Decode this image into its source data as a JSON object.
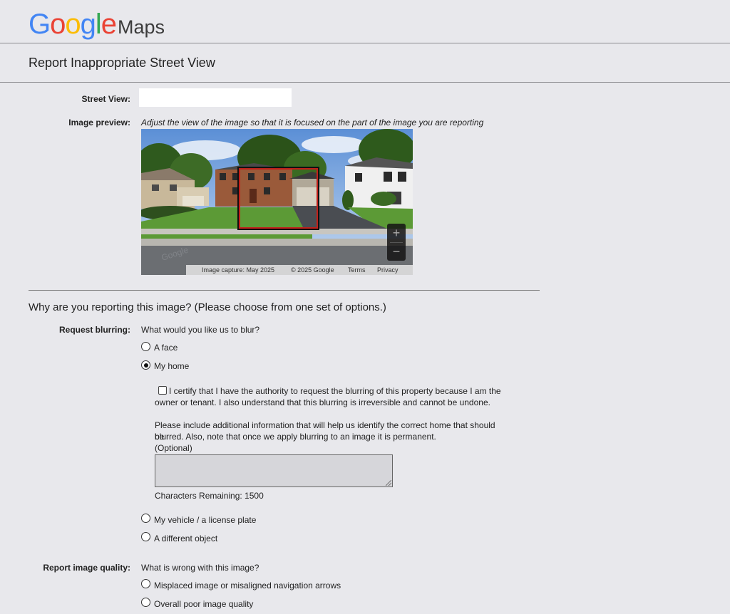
{
  "header": {
    "logo_letters": [
      {
        "ch": "G",
        "color": "#4285F4"
      },
      {
        "ch": "o",
        "color": "#EA4335"
      },
      {
        "ch": "o",
        "color": "#FBBC05"
      },
      {
        "ch": "g",
        "color": "#4285F4"
      },
      {
        "ch": "l",
        "color": "#34A853"
      },
      {
        "ch": "e",
        "color": "#EA4335"
      }
    ],
    "logo_suffix": "Maps"
  },
  "page_title": "Report Inappropriate Street View",
  "street_view": {
    "label": "Street View:",
    "value": ""
  },
  "image_preview": {
    "label": "Image preview:",
    "hint": "Adjust the view of the image so that it is focused on the part of the image you are reporting",
    "zoom_in": "+",
    "zoom_out": "−",
    "attribution": {
      "capture": "Image capture: May 2025",
      "copyright": "© 2025 Google",
      "terms": "Terms",
      "privacy": "Privacy"
    },
    "watermark": "Google"
  },
  "question": "Why are you reporting this image?  (Please choose from one set of options.)",
  "request_blurring": {
    "label": "Request blurring:",
    "prompt": "What would you like us to blur?",
    "options": [
      {
        "label": "A face",
        "checked": false
      },
      {
        "label": "My home",
        "checked": true
      },
      {
        "label": "My vehicle / a license plate",
        "checked": false
      },
      {
        "label": "A different object",
        "checked": false
      }
    ],
    "certify_line1": "I certify that I have the authority to request the blurring of this property because I am the",
    "certify_line2": "owner or tenant. I also understand that this blurring is irreversible and cannot be undone.",
    "certify_checked": false,
    "info_line1": "Please include additional information that will help us identify the correct home that should be",
    "info_line2": "blurred. Also, note that once we apply blurring to an image it is permanent.",
    "optional": "(Optional)",
    "details_value": "",
    "chars_remaining": "Characters Remaining: 1500"
  },
  "image_quality": {
    "label": "Report image quality:",
    "prompt": "What is wrong with this image?",
    "options": [
      {
        "label": "Misplaced image or misaligned navigation arrows",
        "checked": false
      },
      {
        "label": "Overall poor image quality",
        "checked": false
      }
    ]
  },
  "colors": {
    "background": "#e8e8ec",
    "selection_box": "#c0201a"
  }
}
